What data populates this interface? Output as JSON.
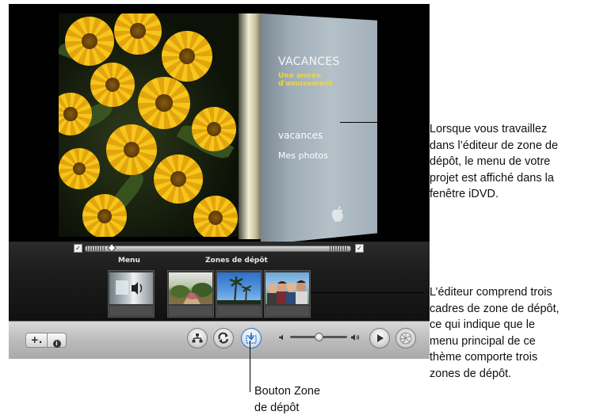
{
  "menu_preview": {
    "title": "VACANCES",
    "subtitle": "Une année d'amusement",
    "items": [
      "vacances",
      "Mes photos"
    ]
  },
  "drop_zone_tray": {
    "menu_label": "Menu",
    "zones_label": "Zones de dépôt"
  },
  "toolbar": {
    "add_label": "+.",
    "info_label": "i"
  },
  "callouts": {
    "menu_text": "Lorsque vous travaillez\ndans l’éditeur de zone de\ndépôt, le menu de votre\nprojet est affiché dans la\nfenêtre iDVD.",
    "frames_text": "L’éditeur comprend trois\ncadres de zone de dépôt,\nce qui indique que le\nmenu principal de ce\nthème comporte trois\nzones de dépôt.",
    "button_text": "Bouton Zone\nde dépôt"
  },
  "icons": [
    "apple-logo",
    "checkbox-icon",
    "sitemap-icon",
    "loop-icon",
    "drop-zone-icon",
    "volume-low-icon",
    "volume-high-icon",
    "play-icon",
    "burn-icon"
  ],
  "colors": {
    "subtitle_yellow": "#f1d63a",
    "drop_zone_button_blue": "#2f74c9"
  }
}
